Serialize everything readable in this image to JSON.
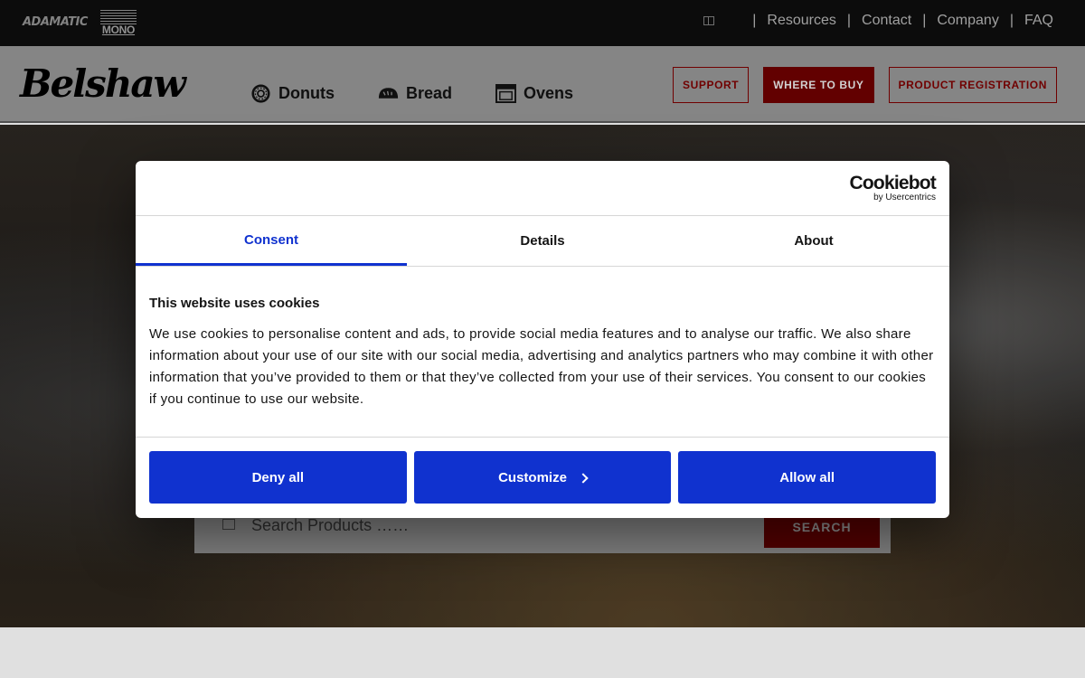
{
  "topbar": {
    "brands": {
      "adamatic": "ADAMATIC",
      "mono": "MONO"
    },
    "links": [
      "Resources",
      "Contact",
      "Company",
      "FAQ"
    ]
  },
  "header": {
    "logo": "Belshaw",
    "nav": [
      {
        "label": "Donuts",
        "icon": "donut-icon"
      },
      {
        "label": "Bread",
        "icon": "bread-icon"
      },
      {
        "label": "Ovens",
        "icon": "oven-icon"
      }
    ],
    "buttons": {
      "support": "SUPPORT",
      "where_to_buy": "WHERE TO BUY",
      "registration": "PRODUCT REGISTRATION"
    }
  },
  "search": {
    "placeholder": "Search Products ……",
    "button": "SEARCH"
  },
  "cookie_dialog": {
    "brand": "Cookiebot",
    "brand_sub": "by Usercentrics",
    "tabs": [
      "Consent",
      "Details",
      "About"
    ],
    "active_tab": "Consent",
    "title": "This website uses cookies",
    "text": "We use cookies to personalise content and ads, to provide social media features and to analyse our traffic. We also share information about your use of our site with our social media, advertising and analytics partners who may combine it with other information that you’ve provided to them or that they’ve collected from your use of their services. You consent to our cookies if you continue to use our website.",
    "buttons": {
      "deny": "Deny all",
      "customize": "Customize",
      "allow": "Allow all"
    },
    "accent_color": "#1032cf"
  }
}
